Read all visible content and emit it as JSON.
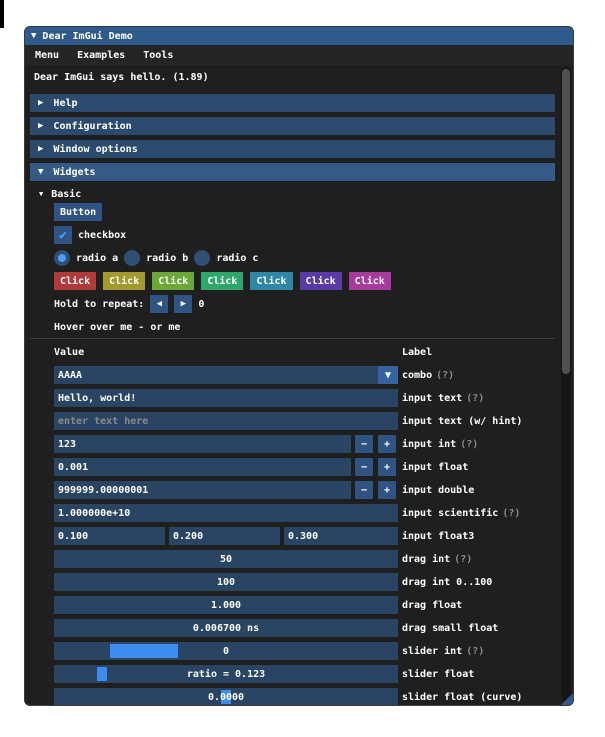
{
  "window": {
    "title": "Dear ImGui Demo"
  },
  "menu": [
    "Menu",
    "Examples",
    "Tools"
  ],
  "intro": "Dear ImGui says hello. (1.89)",
  "headers": {
    "help": "Help",
    "config": "Configuration",
    "window_options": "Window options",
    "widgets": "Widgets"
  },
  "basic": {
    "tree_label": "Basic",
    "button_label": "Button",
    "checkbox_label": "checkbox",
    "radios": [
      "radio a",
      "radio b",
      "radio c"
    ],
    "click_buttons": [
      {
        "label": "Click",
        "color": "#b03a3a"
      },
      {
        "label": "Click",
        "color": "#a39a2e"
      },
      {
        "label": "Click",
        "color": "#6aa838"
      },
      {
        "label": "Click",
        "color": "#2ea86a"
      },
      {
        "label": "Click",
        "color": "#2e87a8"
      },
      {
        "label": "Click",
        "color": "#5a3aa8"
      },
      {
        "label": "Click",
        "color": "#a83a9c"
      }
    ],
    "hold_label": "Hold to repeat:",
    "hold_value": "0",
    "hover_text": "Hover over me - or me"
  },
  "columns": {
    "value": "Value",
    "label": "Label"
  },
  "widgets": {
    "combo": {
      "value": "AAAA",
      "label": "combo",
      "hint": "(?)"
    },
    "input_text": {
      "value": "Hello, world!",
      "label": "input text",
      "hint": "(?)"
    },
    "input_hint": {
      "placeholder": "enter text here",
      "label": "input text (w/ hint)"
    },
    "input_int": {
      "value": "123",
      "label": "input int",
      "hint": "(?)"
    },
    "input_float": {
      "value": "0.001",
      "label": "input float"
    },
    "input_double": {
      "value": "999999.00000001",
      "label": "input double"
    },
    "input_scientific": {
      "value": "1.000000e+10",
      "label": "input scientific",
      "hint": "(?)"
    },
    "input_float3": {
      "values": [
        "0.100",
        "0.200",
        "0.300"
      ],
      "label": "input float3"
    },
    "drag_int": {
      "value": "50",
      "label": "drag int",
      "hint": "(?)"
    },
    "drag_int_range": {
      "value": "100",
      "label": "drag int 0..100"
    },
    "drag_float": {
      "value": "1.000",
      "label": "drag float"
    },
    "drag_small": {
      "value": "0.006700 ns",
      "label": "drag small float"
    },
    "slider_int": {
      "value": "0",
      "label": "slider int",
      "hint": "(?)",
      "fraction": 0.2
    },
    "slider_float": {
      "value": "ratio = 0.123",
      "label": "slider float",
      "fraction": 0.123
    },
    "slider_log": {
      "value": "0.0000",
      "label": "slider float (curve)",
      "fraction": 0.5
    }
  }
}
